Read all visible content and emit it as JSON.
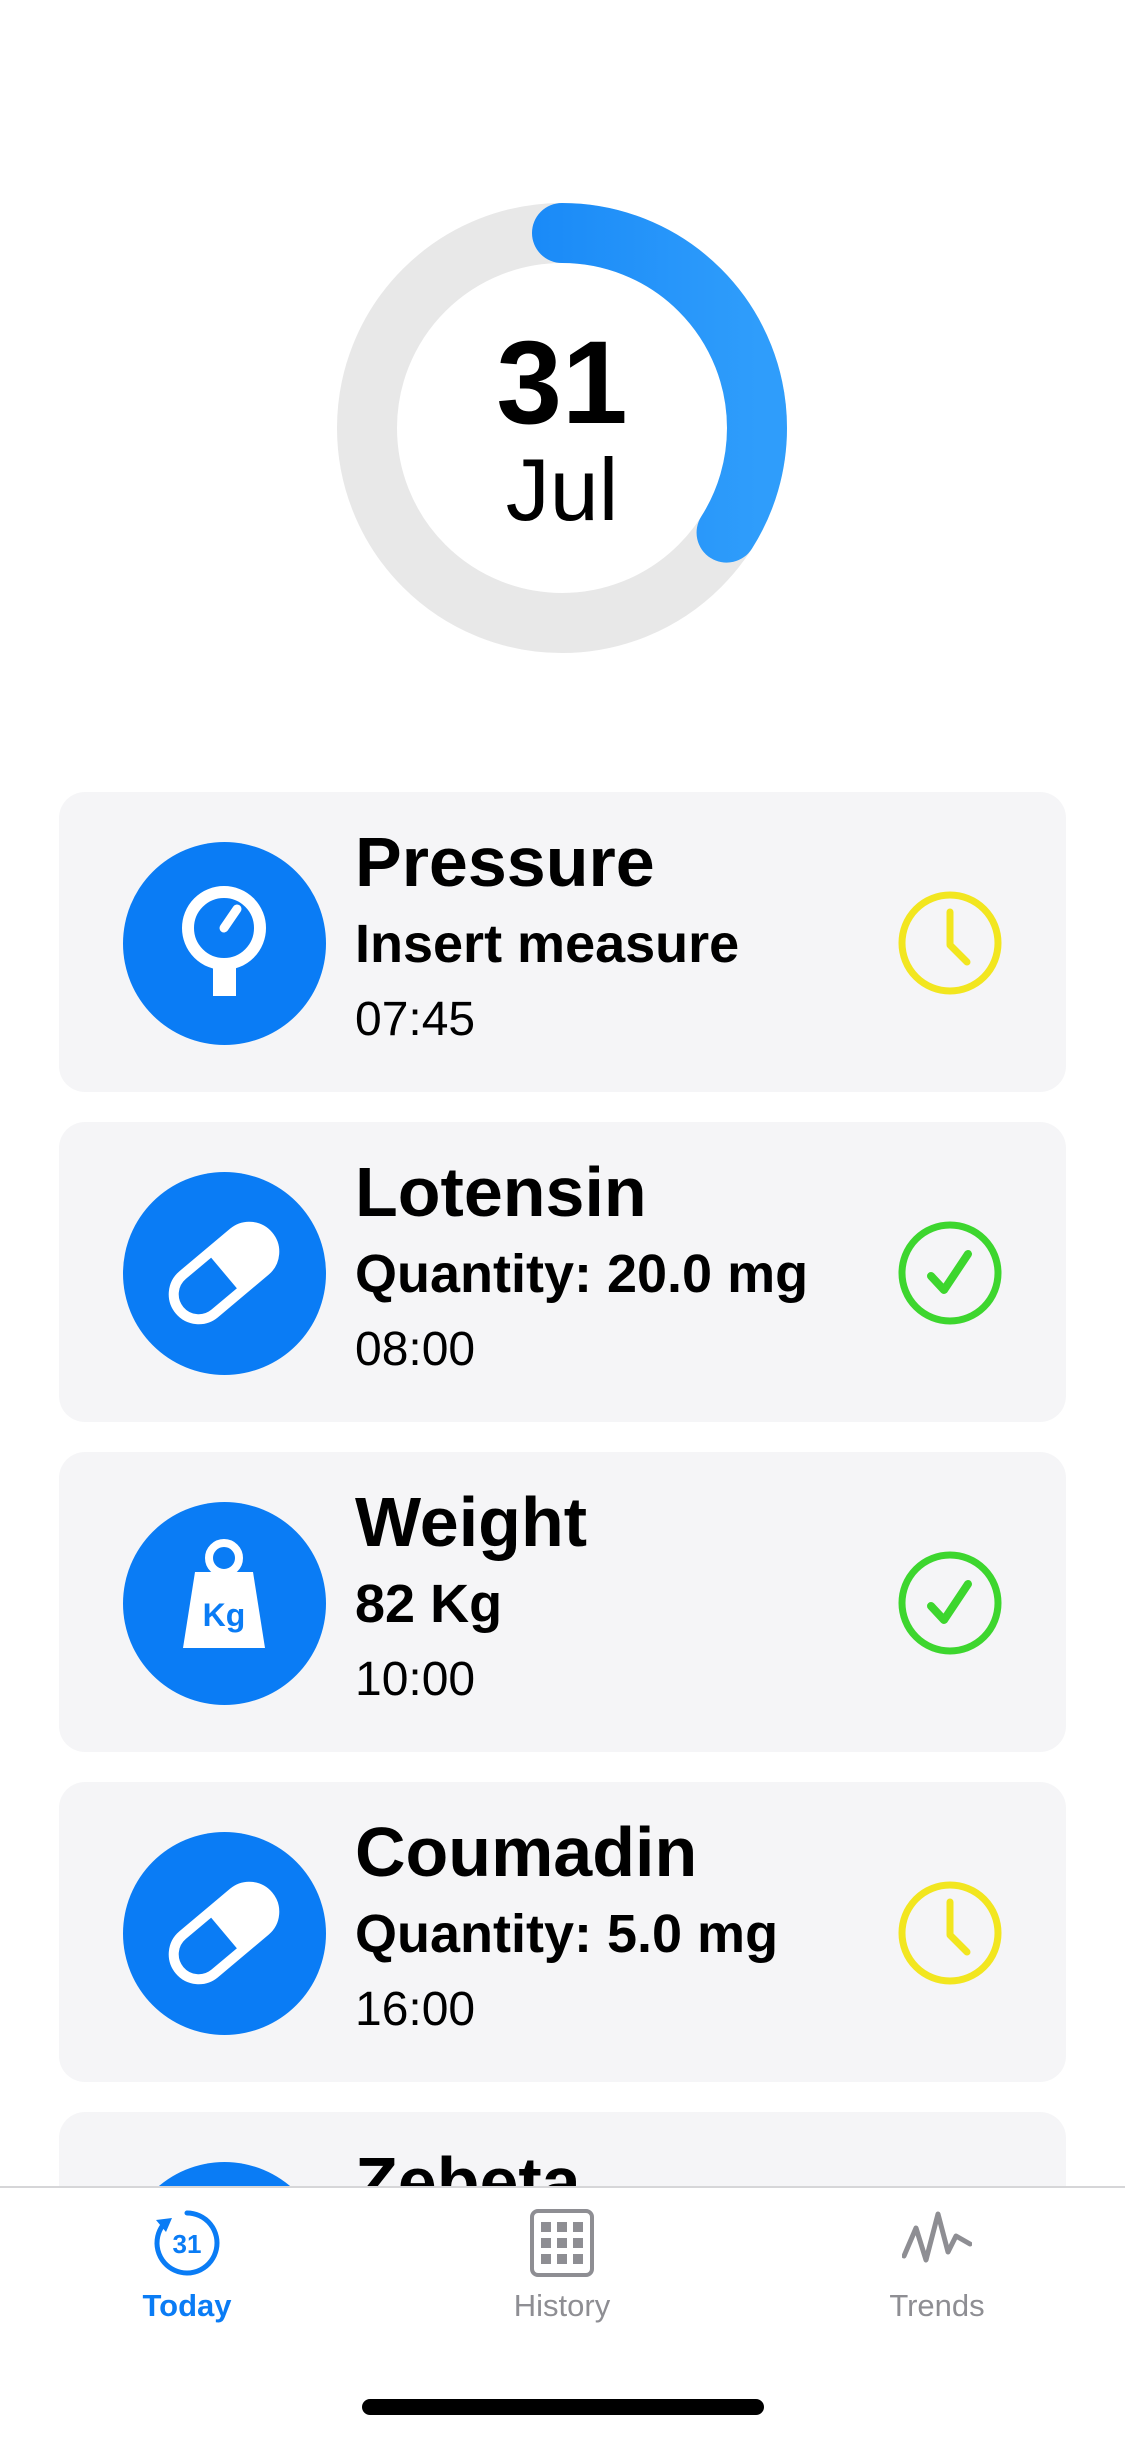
{
  "header": {
    "day": "31",
    "month": "Jul",
    "progress": 0.34
  },
  "entries": [
    {
      "title": "Pressure",
      "detail": "Insert measure",
      "time": "07:45",
      "icon": "gauge-icon",
      "status": "pending"
    },
    {
      "title": "Lotensin",
      "detail": "Quantity: 20.0 mg",
      "time": "08:00",
      "icon": "pill-icon",
      "status": "done"
    },
    {
      "title": "Weight",
      "detail": "82 Kg",
      "time": "10:00",
      "icon": "weight-icon",
      "icon_text": "Kg",
      "status": "done"
    },
    {
      "title": "Coumadin",
      "detail": "Quantity: 5.0 mg",
      "time": "16:00",
      "icon": "pill-icon",
      "status": "pending"
    },
    {
      "title": "Zebeta",
      "icon": "pill-icon"
    }
  ],
  "tabbar": {
    "tabs": [
      {
        "label": "Today",
        "icon": "calendar-today-icon",
        "icon_text": "31",
        "active": true
      },
      {
        "label": "History",
        "icon": "grid-calendar-icon",
        "active": false
      },
      {
        "label": "Trends",
        "icon": "trend-line-icon",
        "active": false
      }
    ]
  },
  "colors": {
    "accent": "#0a7cf5",
    "pending": "#f2e61f",
    "done": "#3dd62e",
    "card_bg": "#f5f5f7",
    "ring_track": "#e8e8e8"
  }
}
